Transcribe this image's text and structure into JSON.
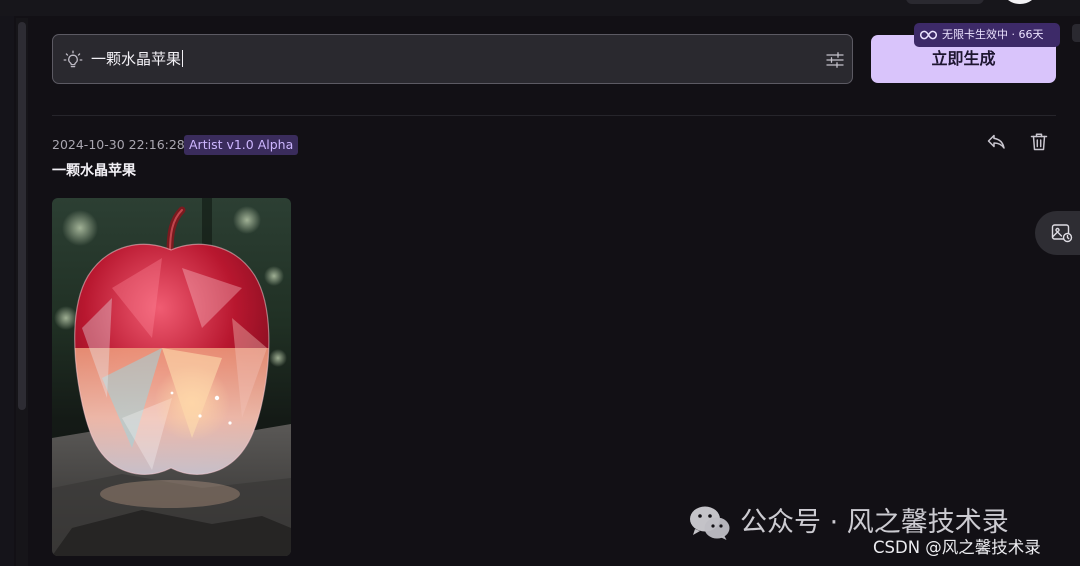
{
  "prompt": {
    "value": "一颗水晶苹果",
    "bulb_icon": "lightbulb-icon",
    "settings_icon": "sliders-icon"
  },
  "generate": {
    "label": "立即生成",
    "badge": "无限卡生效中 · 66天",
    "badge_icon": "infinity-icon"
  },
  "record": {
    "timestamp": "2024-10-30 22:16:28",
    "model": "Artist v1.0 Alpha",
    "title": "一颗水晶苹果",
    "reply_icon": "reply-icon",
    "delete_icon": "trash-icon",
    "image_alt": "一颗水晶苹果"
  },
  "side_tool": {
    "icon": "image-gallery-icon"
  },
  "watermark": {
    "wechat": "公众号 · 风之馨技术录",
    "csdn": "CSDN @风之馨技术录"
  },
  "colors": {
    "background": "#121015",
    "accent": "#d9c4fb",
    "badge": "#3d2a68",
    "tag": "#3a2c5c"
  }
}
